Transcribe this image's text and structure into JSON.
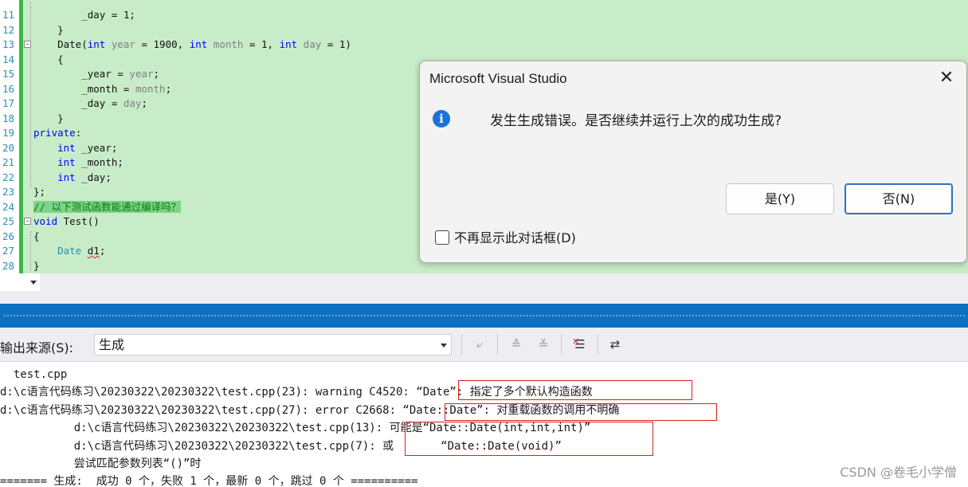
{
  "editor": {
    "lines": [
      {
        "num": "11",
        "segments": [
          {
            "t": "        _day = 1;",
            "c": ""
          }
        ]
      },
      {
        "num": "12",
        "segments": [
          {
            "t": "    }",
            "c": ""
          }
        ]
      },
      {
        "num": "13",
        "segments": [
          {
            "t": "    Date(",
            "c": ""
          },
          {
            "t": "int",
            "c": "kw"
          },
          {
            "t": " year",
            "c": "par"
          },
          {
            "t": " = 1900, ",
            "c": ""
          },
          {
            "t": "int",
            "c": "kw"
          },
          {
            "t": " month",
            "c": "par"
          },
          {
            "t": " = 1, ",
            "c": ""
          },
          {
            "t": "int",
            "c": "kw"
          },
          {
            "t": " day",
            "c": "par"
          },
          {
            "t": " = 1)",
            "c": ""
          }
        ]
      },
      {
        "num": "14",
        "segments": [
          {
            "t": "    {",
            "c": ""
          }
        ]
      },
      {
        "num": "15",
        "segments": [
          {
            "t": "        _year = ",
            "c": ""
          },
          {
            "t": "year",
            "c": "par"
          },
          {
            "t": ";",
            "c": ""
          }
        ]
      },
      {
        "num": "16",
        "segments": [
          {
            "t": "        _month = ",
            "c": ""
          },
          {
            "t": "month",
            "c": "par"
          },
          {
            "t": ";",
            "c": ""
          }
        ]
      },
      {
        "num": "17",
        "segments": [
          {
            "t": "        _day = ",
            "c": ""
          },
          {
            "t": "day",
            "c": "par"
          },
          {
            "t": ";",
            "c": ""
          }
        ]
      },
      {
        "num": "18",
        "segments": [
          {
            "t": "    }",
            "c": ""
          }
        ]
      },
      {
        "num": "19",
        "segments": [
          {
            "t": "private",
            "c": "kw"
          },
          {
            "t": ":",
            "c": ""
          }
        ]
      },
      {
        "num": "20",
        "segments": [
          {
            "t": "    ",
            "c": ""
          },
          {
            "t": "int",
            "c": "kw"
          },
          {
            "t": " _year;",
            "c": ""
          }
        ]
      },
      {
        "num": "21",
        "segments": [
          {
            "t": "    ",
            "c": ""
          },
          {
            "t": "int",
            "c": "kw"
          },
          {
            "t": " _month;",
            "c": ""
          }
        ]
      },
      {
        "num": "22",
        "segments": [
          {
            "t": "    ",
            "c": ""
          },
          {
            "t": "int",
            "c": "kw"
          },
          {
            "t": " _day;",
            "c": ""
          }
        ]
      },
      {
        "num": "23",
        "segments": [
          {
            "t": "};",
            "c": ""
          }
        ]
      },
      {
        "num": "24",
        "segments": [
          {
            "t": "// 以下测试函数能通过编译吗？",
            "c": "cm"
          }
        ]
      },
      {
        "num": "25",
        "segments": [
          {
            "t": "void",
            "c": "kw"
          },
          {
            "t": " Test()",
            "c": ""
          }
        ]
      },
      {
        "num": "26",
        "segments": [
          {
            "t": "{",
            "c": ""
          }
        ]
      },
      {
        "num": "27",
        "segments": [
          {
            "t": "    ",
            "c": ""
          },
          {
            "t": "Date",
            "c": "ty"
          },
          {
            "t": " ",
            "c": ""
          },
          {
            "t": "d1",
            "c": "sq"
          },
          {
            "t": ";",
            "c": ""
          }
        ]
      },
      {
        "num": "28",
        "segments": [
          {
            "t": "}",
            "c": ""
          }
        ]
      }
    ]
  },
  "dialog": {
    "title": "Microsoft Visual Studio",
    "close_glyph": "✕",
    "info_glyph": "i",
    "message": "发生生成错误。是否继续并运行上次的成功生成?",
    "yes_label": "是(Y)",
    "no_label": "否(N)",
    "dont_show_label": "不再显示此对话框(D)"
  },
  "output_toolbar": {
    "source_label": "输出来源(S):",
    "source_value": "生成"
  },
  "output": {
    "lines": [
      "  test.cpp",
      "d:\\c语言代码练习\\20230322\\20230322\\test.cpp(23): warning C4520: “Date”: 指定了多个默认构造函数",
      "d:\\c语言代码练习\\20230322\\20230322\\test.cpp(27): error C2668: “Date::Date”: 对重载函数的调用不明确",
      "           d:\\c语言代码练习\\20230322\\20230322\\test.cpp(13): 可能是“Date::Date(int,int,int)”",
      "           d:\\c语言代码练习\\20230322\\20230322\\test.cpp(7): 或       “Date::Date(void)”",
      "           尝试匹配参数列表“()”时",
      "======= 生成:  成功 0 个，失败 1 个，最新 0 个，跳过 0 个 =========="
    ]
  },
  "watermark": "CSDN @卷毛小学僧",
  "colors": {
    "editor_bg": "#c8ecc8",
    "accent_blue": "#0e70c0",
    "error_box": "#d42020",
    "keyword": "#0000ff"
  }
}
